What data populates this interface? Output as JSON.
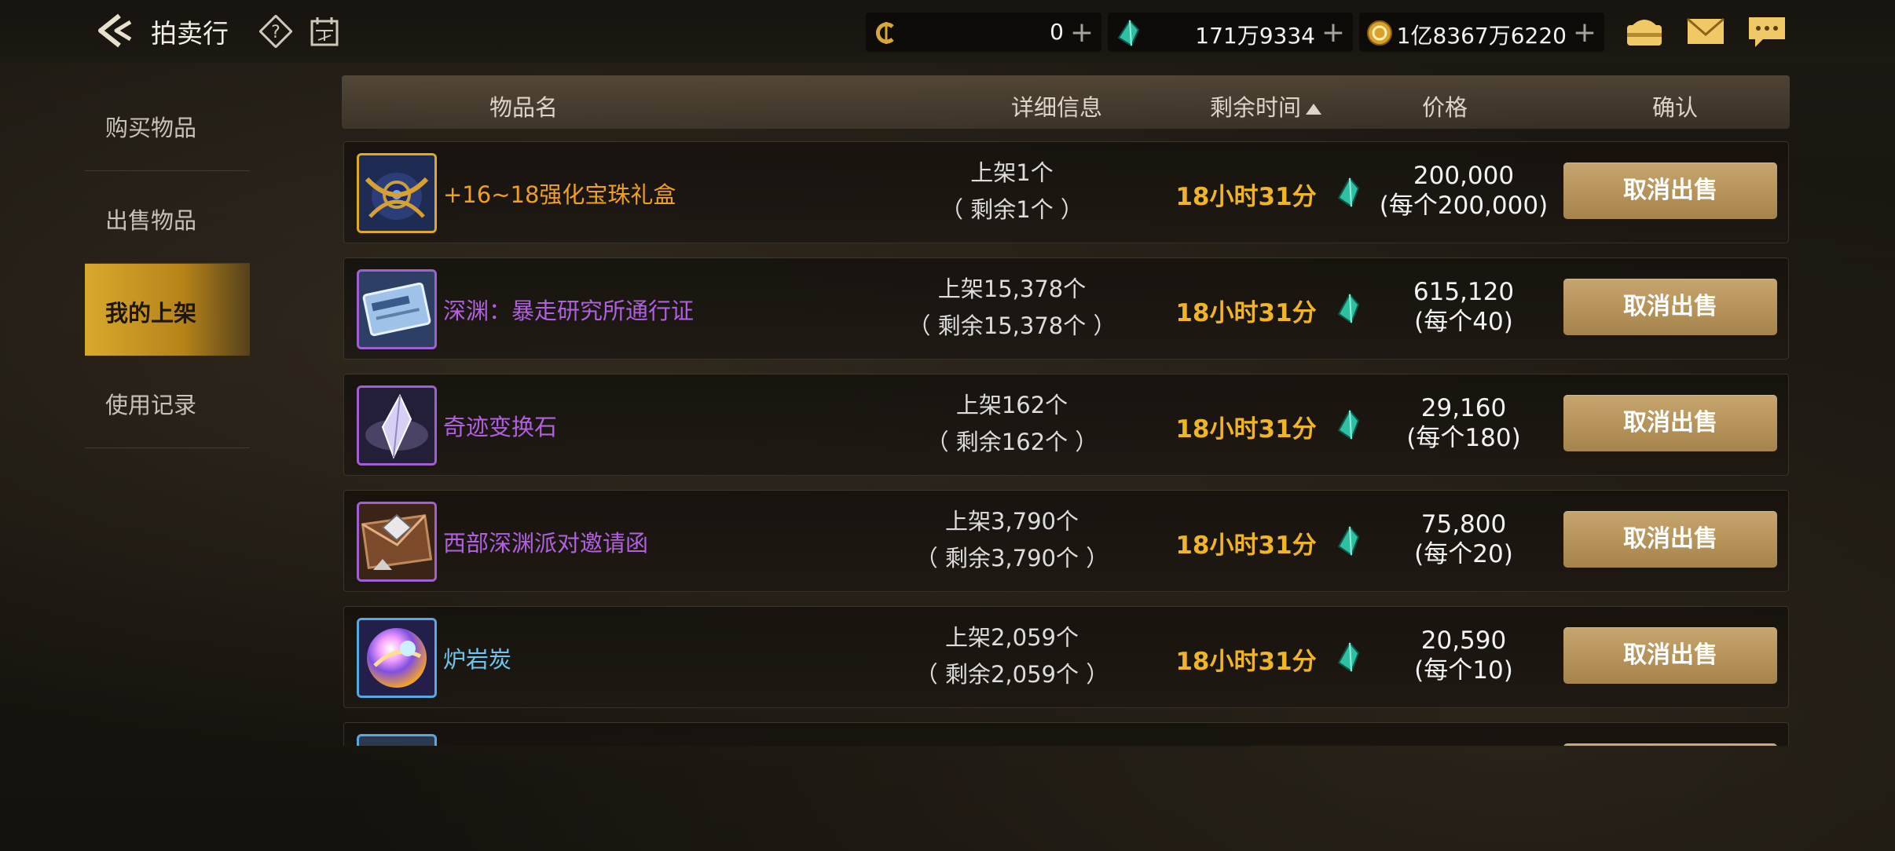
{
  "header": {
    "title": "拍卖行",
    "back_icon": "back-arrow-icon",
    "help_icon": "help-icon",
    "calendar_icon": "calendar-icon"
  },
  "currencies": [
    {
      "icon": "coin-c-icon",
      "value": "0"
    },
    {
      "icon": "gem-icon",
      "value": "171万9334"
    },
    {
      "icon": "gold-coin-icon",
      "value": "1亿8367万6220"
    }
  ],
  "top_icons": [
    "wallet-icon",
    "mail-icon",
    "chat-icon"
  ],
  "sidebar": {
    "items": [
      {
        "label": "购买物品"
      },
      {
        "label": "出售物品"
      },
      {
        "label": "我的上架"
      },
      {
        "label": "使用记录"
      }
    ],
    "active_index": 2
  },
  "table": {
    "headers": {
      "name": "物品名",
      "detail": "详细信息",
      "time": "剩余时间",
      "price": "价格",
      "confirm": "确认"
    },
    "rows": [
      {
        "name": "+16~18强化宝珠礼盒",
        "name_color": "#f0a020",
        "icon": "orb-gift-box-icon",
        "listed": "上架1个",
        "remaining": "（ 剩余1个 ）",
        "time": "18小时31分",
        "price": "200,000",
        "unit": "(每个200,000)",
        "action": "取消出售"
      },
      {
        "name": "深渊：暴走研究所通行证",
        "name_color": "#b060e0",
        "icon": "pass-ticket-icon",
        "listed": "上架15,378个",
        "remaining": "（ 剩余15,378个 ）",
        "time": "18小时31分",
        "price": "615,120",
        "unit": "(每个40)",
        "action": "取消出售"
      },
      {
        "name": "奇迹变换石",
        "name_color": "#b060e0",
        "icon": "crystal-stone-icon",
        "listed": "上架162个",
        "remaining": "（ 剩余162个 ）",
        "time": "18小时31分",
        "price": "29,160",
        "unit": "(每个180)",
        "action": "取消出售"
      },
      {
        "name": "西部深渊派对邀请函",
        "name_color": "#b060e0",
        "icon": "invitation-letter-icon",
        "listed": "上架3,790个",
        "remaining": "（ 剩余3,790个 ）",
        "time": "18小时31分",
        "price": "75,800",
        "unit": "(每个20)",
        "action": "取消出售"
      },
      {
        "name": "炉岩炭",
        "name_color": "#6ec6f0",
        "icon": "rainbow-orb-icon",
        "listed": "上架2,059个",
        "remaining": "（ 剩余2,059个 ）",
        "time": "18小时31分",
        "price": "20,590",
        "unit": "(每个10)",
        "action": "取消出售"
      }
    ]
  },
  "colors": {
    "time": "#f0b429",
    "active_tab": "#d9a92d",
    "button": "#b89358"
  }
}
